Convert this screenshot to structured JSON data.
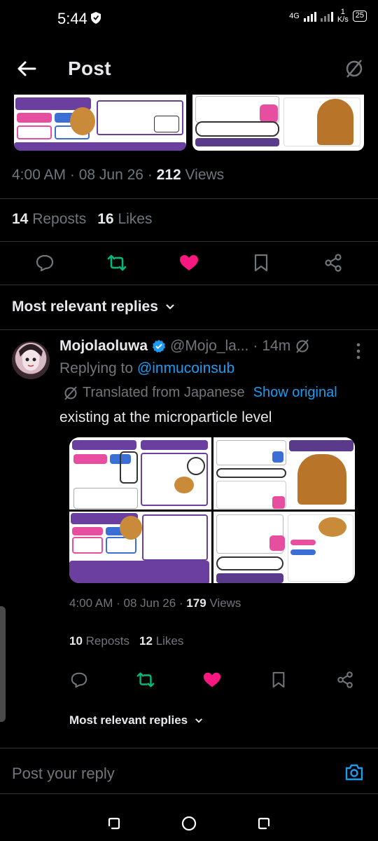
{
  "status_bar": {
    "time": "5:44",
    "network": "4G",
    "speed_value": "1",
    "speed_unit": "K/s",
    "battery": "25"
  },
  "header": {
    "title": "Post"
  },
  "post": {
    "time": "4:00 AM",
    "date": "08 Jun 26",
    "views": "212",
    "views_label": "Views",
    "reposts": "14",
    "reposts_label": "Reposts",
    "likes": "16",
    "likes_label": "Likes"
  },
  "sort": {
    "label": "Most relevant replies"
  },
  "reply": {
    "name": "Mojolaoluwa",
    "handle": "@Mojo_la...",
    "age": "14m",
    "replying_prefix": "Replying to",
    "replying_to": "@inmucoinsub",
    "translated_label": "Translated from Japanese",
    "show_original": "Show original",
    "text": "existing at the microparticle level",
    "time": "4:00 AM",
    "date": "08 Jun 26",
    "views": "179",
    "views_label": "Views",
    "reposts": "10",
    "reposts_label": "Reposts",
    "likes": "12",
    "likes_label": "Likes",
    "sort_label": "Most relevant replies"
  },
  "composer": {
    "placeholder": "Post your reply"
  },
  "colors": {
    "background": "#000000",
    "accent": "#1d9bf0",
    "like": "#f91880",
    "repost": "#00ba7c",
    "muted": "#71767b"
  }
}
